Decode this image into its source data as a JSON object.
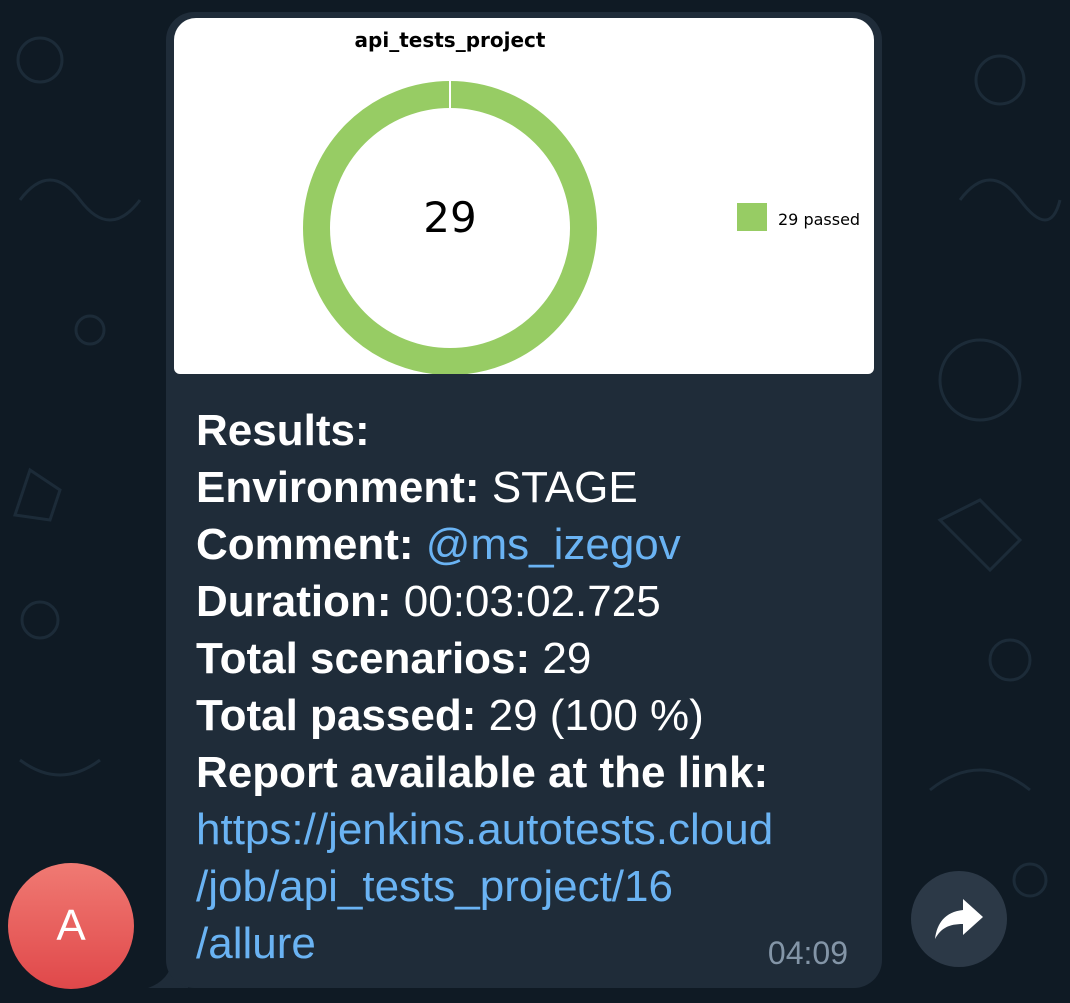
{
  "colors": {
    "background": "#0f1a24",
    "bubble": "#1f2c39",
    "link": "#6ab3f3",
    "passed": "#97cc64",
    "avatar": "#e0484a",
    "timestamp": "#8395a7"
  },
  "message": {
    "chart_image": {
      "title": "api_tests_project",
      "center_value": "29",
      "legend": [
        {
          "label": "29 passed",
          "color": "#97cc64"
        }
      ]
    },
    "lines": {
      "results_label": "Results:",
      "environment_label": "Environment:",
      "environment_value": "STAGE",
      "comment_label": "Comment:",
      "comment_mention": "@ms_izegov",
      "duration_label": "Duration:",
      "duration_value": "00:03:02.725",
      "scenarios_label": "Total scenarios:",
      "scenarios_value": "29",
      "passed_label": "Total passed:",
      "passed_value": "29 (100 %)",
      "report_label": "Report available at the link:",
      "report_link_line1": "https://jenkins.autotests.cloud",
      "report_link_line2": "/job/api_tests_project/16",
      "report_link_line3": "/allure"
    },
    "time": "04:09"
  },
  "sender": {
    "avatar_letter": "A"
  },
  "actions": {
    "share_icon": "share-arrow-icon"
  },
  "chart_data": {
    "type": "pie",
    "title": "api_tests_project",
    "categories": [
      "passed"
    ],
    "values": [
      29
    ],
    "series": [
      {
        "name": "29 passed",
        "values": [
          29
        ]
      }
    ],
    "center_label": "29",
    "legend_position": "right"
  }
}
